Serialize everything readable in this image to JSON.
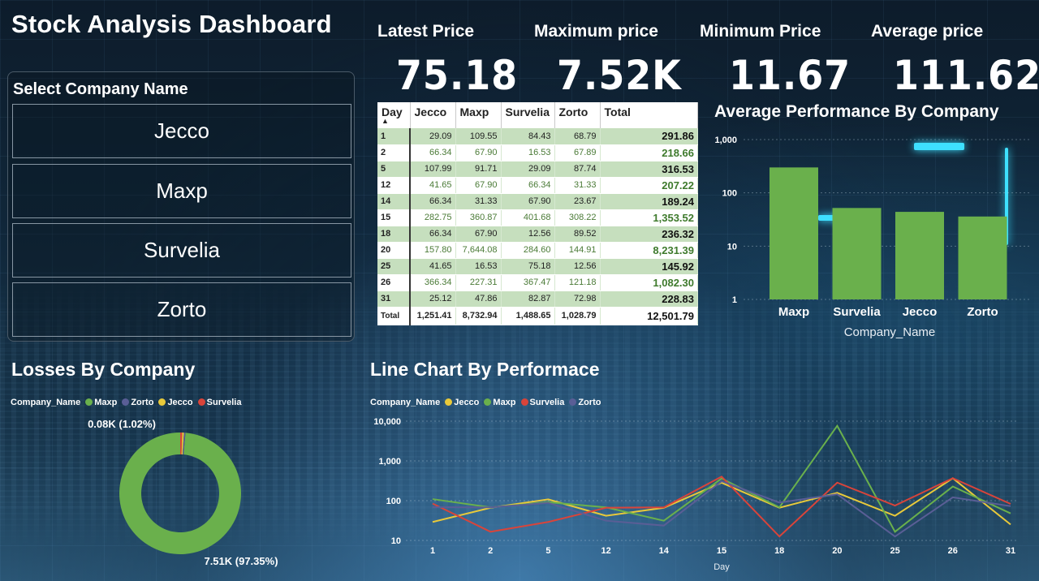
{
  "title": "Stock Analysis Dashboard",
  "kpis": [
    {
      "label": "Latest Price",
      "value": "75.18"
    },
    {
      "label": "Maximum price",
      "value": "7.52K"
    },
    {
      "label": "Minimum Price",
      "value": "11.67"
    },
    {
      "label": "Average price",
      "value": "111.62"
    }
  ],
  "slicer": {
    "title": "Select Company Name",
    "items": [
      "Jecco",
      "Maxp",
      "Survelia",
      "Zorto"
    ]
  },
  "matrix": {
    "headers": [
      "Day",
      "Jecco",
      "Maxp",
      "Survelia",
      "Zorto",
      "Total"
    ],
    "rows": [
      [
        "1",
        "29.09",
        "109.55",
        "84.43",
        "68.79",
        "291.86"
      ],
      [
        "2",
        "66.34",
        "67.90",
        "16.53",
        "67.89",
        "218.66"
      ],
      [
        "5",
        "107.99",
        "91.71",
        "29.09",
        "87.74",
        "316.53"
      ],
      [
        "12",
        "41.65",
        "67.90",
        "66.34",
        "31.33",
        "207.22"
      ],
      [
        "14",
        "66.34",
        "31.33",
        "67.90",
        "23.67",
        "189.24"
      ],
      [
        "15",
        "282.75",
        "360.87",
        "401.68",
        "308.22",
        "1,353.52"
      ],
      [
        "18",
        "66.34",
        "67.90",
        "12.56",
        "89.52",
        "236.32"
      ],
      [
        "20",
        "157.80",
        "7,644.08",
        "284.60",
        "144.91",
        "8,231.39"
      ],
      [
        "25",
        "41.65",
        "16.53",
        "75.18",
        "12.56",
        "145.92"
      ],
      [
        "26",
        "366.34",
        "227.31",
        "367.47",
        "121.18",
        "1,082.30"
      ],
      [
        "31",
        "25.12",
        "47.86",
        "82.87",
        "72.98",
        "228.83"
      ]
    ],
    "total_row": [
      "Total",
      "1,251.41",
      "8,732.94",
      "1,488.65",
      "1,028.79",
      "12,501.79"
    ]
  },
  "bar_title": "Average Performance By Company",
  "donut_title": "Losses By Company",
  "line_title": "Line Chart By Performace",
  "donut_legend_title": "Company_Name",
  "line_legend_title": "Company_Name",
  "colors": {
    "Jecco": "#e8c93a",
    "Maxp": "#6ab04c",
    "Survelia": "#d9443a",
    "Zorto": "#5a5e96",
    "bar": "#6ab04c"
  },
  "chart_data": [
    {
      "type": "bar",
      "title": "Average Performance By Company",
      "categories": [
        "Maxp",
        "Survelia",
        "Jecco",
        "Zorto"
      ],
      "values": [
        300,
        52,
        44,
        36
      ],
      "xlabel": "Company_Name",
      "ylabel": "",
      "yscale": "log",
      "ylim": [
        1,
        1000
      ],
      "yticks": [
        "1",
        "10",
        "100",
        "1,000"
      ],
      "grid": true
    },
    {
      "type": "pie",
      "title": "Losses By Company",
      "legend_title": "Company_Name",
      "legend_order": [
        "Maxp",
        "Zorto",
        "Jecco",
        "Survelia"
      ],
      "slices": [
        {
          "name": "Maxp",
          "value": 7510,
          "label": "7.51K (97.35%)"
        },
        {
          "name": "Survelia",
          "value": 40,
          "label": "0.08K (1.02%)"
        },
        {
          "name": "Jecco",
          "value": 35
        },
        {
          "name": "Zorto",
          "value": 30
        }
      ],
      "donut": true
    },
    {
      "type": "line",
      "title": "Line Chart By Performace",
      "legend_title": "Company_Name",
      "xlabel": "Day",
      "x": [
        "1",
        "2",
        "5",
        "12",
        "14",
        "15",
        "18",
        "20",
        "25",
        "26",
        "31"
      ],
      "yscale": "log",
      "ylim": [
        10,
        10000
      ],
      "yticks": [
        "10",
        "100",
        "1,000",
        "10,000"
      ],
      "series": [
        {
          "name": "Jecco",
          "values": [
            29.09,
            66.34,
            107.99,
            41.65,
            66.34,
            282.75,
            66.34,
            157.8,
            41.65,
            366.34,
            25.12
          ]
        },
        {
          "name": "Maxp",
          "values": [
            109.55,
            67.9,
            91.71,
            67.9,
            31.33,
            360.87,
            67.9,
            7644.08,
            16.53,
            227.31,
            47.86
          ]
        },
        {
          "name": "Survelia",
          "values": [
            84.43,
            16.53,
            29.09,
            66.34,
            67.9,
            401.68,
            12.56,
            284.6,
            75.18,
            367.47,
            82.87
          ]
        },
        {
          "name": "Zorto",
          "values": [
            68.79,
            67.89,
            87.74,
            31.33,
            23.67,
            308.22,
            89.52,
            144.91,
            12.56,
            121.18,
            72.98
          ]
        }
      ]
    }
  ]
}
